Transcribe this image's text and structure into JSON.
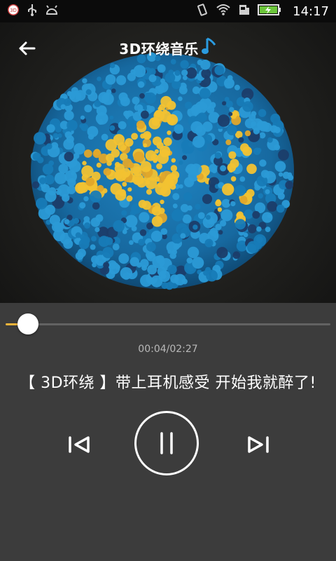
{
  "status_bar": {
    "time": "14:17",
    "left_icons": [
      "3d-app-icon",
      "usb-icon",
      "android-debug-icon"
    ],
    "right_icons": [
      "vibrate-icon",
      "wifi-icon",
      "sim-icon",
      "battery-charging-icon"
    ]
  },
  "header": {
    "title": "3D环绕音乐",
    "music_note_icon": "music-note-icon",
    "back_icon": "back-arrow-icon"
  },
  "album_art": {
    "description_icon": "speaker-sound-icon",
    "colors": {
      "dots_primary": "#2b9ad6",
      "dots_secondary": "#177bb7",
      "dots_accent": "#f2c232",
      "dots_dark": "#1b3d6a"
    }
  },
  "player": {
    "progress_fraction": 0.069,
    "current_time": "00:04",
    "total_time": "02:27",
    "time_text": "00:04/02:27",
    "song_title": "【 3D环绕 】带上耳机感受  开始我就醉了!",
    "controls": {
      "prev_icon": "skip-previous-icon",
      "play_state_icon": "pause-icon",
      "next_icon": "skip-next-icon"
    },
    "colors": {
      "progress": "#f0b43a",
      "track": "#626262"
    }
  }
}
